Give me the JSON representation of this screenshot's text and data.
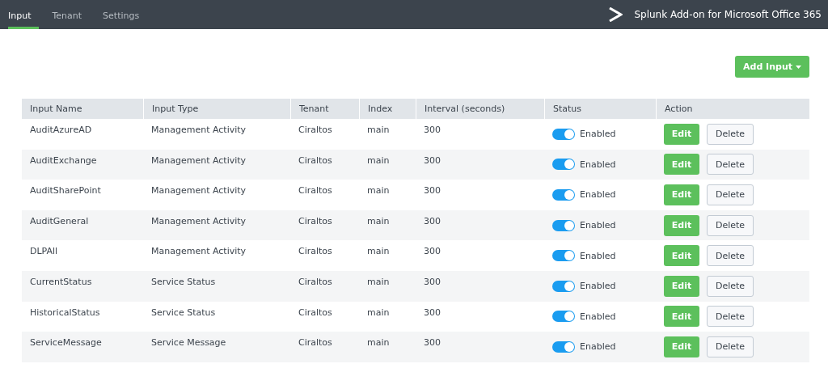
{
  "tabs": [
    {
      "label": "Input",
      "selected": true
    },
    {
      "label": "Tenant",
      "selected": false
    },
    {
      "label": "Settings",
      "selected": false
    }
  ],
  "app_title": "Splunk Add-on for Microsoft Office 365",
  "add_button": {
    "label": "Add Input",
    "dropdown": true
  },
  "table": {
    "columns": [
      "Input Name",
      "Input Type",
      "Tenant",
      "Index",
      "Interval (seconds)",
      "Status",
      "Action"
    ],
    "rows": [
      {
        "name": "AuditAzureAD",
        "type": "Management Activity",
        "tenant": "Ciraltos",
        "index": "main",
        "interval": "300",
        "on": true,
        "status": "Enabled",
        "edit": "Edit",
        "delete": "Delete"
      },
      {
        "name": "AuditExchange",
        "type": "Management Activity",
        "tenant": "Ciraltos",
        "index": "main",
        "interval": "300",
        "on": true,
        "status": "Enabled",
        "edit": "Edit",
        "delete": "Delete"
      },
      {
        "name": "AuditSharePoint",
        "type": "Management Activity",
        "tenant": "Ciraltos",
        "index": "main",
        "interval": "300",
        "on": true,
        "status": "Enabled",
        "edit": "Edit",
        "delete": "Delete"
      },
      {
        "name": "AuditGeneral",
        "type": "Management Activity",
        "tenant": "Ciraltos",
        "index": "main",
        "interval": "300",
        "on": true,
        "status": "Enabled",
        "edit": "Edit",
        "delete": "Delete"
      },
      {
        "name": "DLPAll",
        "type": "Management Activity",
        "tenant": "Ciraltos",
        "index": "main",
        "interval": "300",
        "on": true,
        "status": "Enabled",
        "edit": "Edit",
        "delete": "Delete"
      },
      {
        "name": "CurrentStatus",
        "type": "Service Status",
        "tenant": "Ciraltos",
        "index": "main",
        "interval": "300",
        "on": true,
        "status": "Enabled",
        "edit": "Edit",
        "delete": "Delete"
      },
      {
        "name": "HistoricalStatus",
        "type": "Service Status",
        "tenant": "Ciraltos",
        "index": "main",
        "interval": "300",
        "on": true,
        "status": "Enabled",
        "edit": "Edit",
        "delete": "Delete"
      },
      {
        "name": "ServiceMessage",
        "type": "Service Message",
        "tenant": "Ciraltos",
        "index": "main",
        "interval": "300",
        "on": true,
        "status": "Enabled",
        "edit": "Edit",
        "delete": "Delete"
      }
    ]
  }
}
